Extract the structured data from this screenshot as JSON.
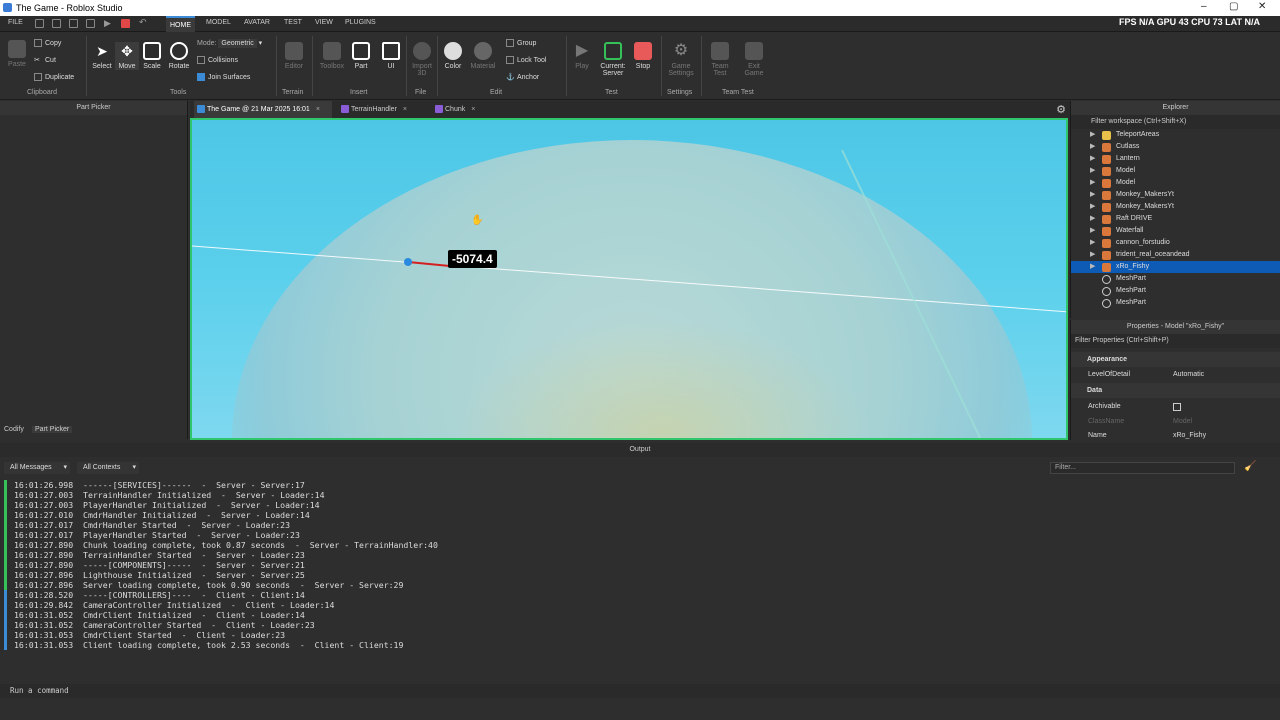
{
  "window": {
    "title": "The Game - Roblox Studio"
  },
  "stats": {
    "text": "FPS N/A GPU 43 CPU 73 LAT N/A"
  },
  "menu": {
    "items": [
      "FILE",
      "HOME",
      "MODEL",
      "AVATAR",
      "TEST",
      "VIEW",
      "PLUGINS"
    ]
  },
  "ribbon": {
    "paste": "Paste",
    "copy": "Copy",
    "cut": "Cut",
    "duplicate": "Duplicate",
    "clipboard": "Clipboard",
    "select": "Select",
    "move": "Move",
    "scale": "Scale",
    "rotate": "Rotate",
    "tools": "Tools",
    "mode_label": "Mode:",
    "mode_value": "Geometric",
    "collisions": "Collisions",
    "join_surfaces": "Join Surfaces",
    "editor": "Editor",
    "terrain": "Terrain",
    "toolbox": "Toolbox",
    "part": "Part",
    "ui": "UI",
    "insert": "Insert",
    "import3d": "Import 3D",
    "file": "File",
    "color": "Color",
    "material": "Material",
    "group": "Group",
    "lock_tool": "Lock Tool",
    "anchor": "Anchor",
    "edit": "Edit",
    "play": "Play",
    "current_server": "Current: Server",
    "stop": "Stop",
    "test": "Test",
    "game_settings": "Game Settings",
    "settings": "Settings",
    "team_test": "Team Test",
    "exit_game": "Exit Game",
    "team_test_group": "Team Test"
  },
  "left_pane": {
    "title": "Part Picker",
    "tabs": [
      "Codify",
      "Part Picker"
    ]
  },
  "doc_tabs": [
    {
      "label": "The Game @ 21 Mar 2025 16:01",
      "color": "#3b8bd6"
    },
    {
      "label": "TerrainHandler",
      "color": "#8a5cd6"
    },
    {
      "label": "Chunk",
      "color": "#8a5cd6"
    }
  ],
  "viewport": {
    "measure": "-5074.4"
  },
  "explorer": {
    "title": "Explorer",
    "filter": "Filter workspace (Ctrl+Shift+X)",
    "items": [
      {
        "label": "TeleportAreas",
        "icon": "folder-icon",
        "color": "#e8c04a"
      },
      {
        "label": "Cutlass",
        "icon": "model-icon",
        "color": "#d9783a"
      },
      {
        "label": "Lantern",
        "icon": "model-icon",
        "color": "#d9783a"
      },
      {
        "label": "Model",
        "icon": "model-icon",
        "color": "#d9783a"
      },
      {
        "label": "Model",
        "icon": "model-icon",
        "color": "#d9783a"
      },
      {
        "label": "Monkey_MakersYt",
        "icon": "model-icon",
        "color": "#d9783a"
      },
      {
        "label": "Monkey_MakersYt",
        "icon": "model-icon",
        "color": "#d9783a"
      },
      {
        "label": "Raft DRIVE",
        "icon": "model-icon",
        "color": "#d9783a"
      },
      {
        "label": "Waterfall",
        "icon": "model-icon",
        "color": "#d9783a"
      },
      {
        "label": "cannon_forstudio",
        "icon": "model-icon",
        "color": "#d9783a"
      },
      {
        "label": "trident_real_oceandead",
        "icon": "model-icon",
        "color": "#d9783a"
      },
      {
        "label": "xRo_Fishy",
        "icon": "model-icon",
        "color": "#d9783a",
        "selected": true
      },
      {
        "label": "MeshPart",
        "icon": "mesh-icon",
        "color": "#cfcfcf"
      },
      {
        "label": "MeshPart",
        "icon": "mesh-icon",
        "color": "#cfcfcf"
      },
      {
        "label": "MeshPart",
        "icon": "mesh-icon",
        "color": "#cfcfcf"
      }
    ]
  },
  "properties": {
    "title": "Properties - Model \"xRo_Fishy\"",
    "filter": "Filter Properties (Ctrl+Shift+P)",
    "appearance": "Appearance",
    "lod_label": "LevelOfDetail",
    "lod_value": "Automatic",
    "data": "Data",
    "archivable": "Archivable",
    "classname_label": "ClassName",
    "classname_value": "Model",
    "name_label": "Name",
    "name_value": "xRo_Fishy"
  },
  "output": {
    "title": "Output",
    "all_messages": "All Messages",
    "all_contexts": "All Contexts",
    "filter_placeholder": "Filter...",
    "lines": [
      {
        "text": "16:01:26.998  ------[SERVICES]------  -  Server - Server:17",
        "side": "server"
      },
      {
        "text": "16:01:27.003  TerrainHandler Initialized  -  Server - Loader:14",
        "side": "server"
      },
      {
        "text": "16:01:27.003  PlayerHandler Initialized  -  Server - Loader:14",
        "side": "server"
      },
      {
        "text": "16:01:27.010  CmdrHandler Initialized  -  Server - Loader:14",
        "side": "server"
      },
      {
        "text": "16:01:27.017  CmdrHandler Started  -  Server - Loader:23",
        "side": "server"
      },
      {
        "text": "16:01:27.017  PlayerHandler Started  -  Server - Loader:23",
        "side": "server"
      },
      {
        "text": "16:01:27.890  Chunk loading complete, took 0.87 seconds  -  Server - TerrainHandler:40",
        "side": "server"
      },
      {
        "text": "16:01:27.890  TerrainHandler Started  -  Server - Loader:23",
        "side": "server"
      },
      {
        "text": "16:01:27.890  -----[COMPONENTS]-----  -  Server - Server:21",
        "side": "server"
      },
      {
        "text": "16:01:27.896  Lighthouse Initialized  -  Server - Server:25",
        "side": "server"
      },
      {
        "text": "16:01:27.896  Server loading complete, took 0.90 seconds  -  Server - Server:29",
        "side": "server"
      },
      {
        "text": "16:01:28.520  -----[CONTROLLERS]----  -  Client - Client:14",
        "side": "client"
      },
      {
        "text": "16:01:29.842  CameraController Initialized  -  Client - Loader:14",
        "side": "client"
      },
      {
        "text": "16:01:31.052  CmdrClient Initialized  -  Client - Loader:14",
        "side": "client"
      },
      {
        "text": "16:01:31.052  CameraController Started  -  Client - Loader:23",
        "side": "client"
      },
      {
        "text": "16:01:31.053  CmdrClient Started  -  Client - Loader:23",
        "side": "client"
      },
      {
        "text": "16:01:31.053  Client loading complete, took 2.53 seconds  -  Client - Client:19",
        "side": "client"
      }
    ],
    "colors": {
      "server": "#35c05a",
      "client": "#3b8bd6"
    }
  },
  "command_bar": {
    "placeholder": "Run a command"
  }
}
